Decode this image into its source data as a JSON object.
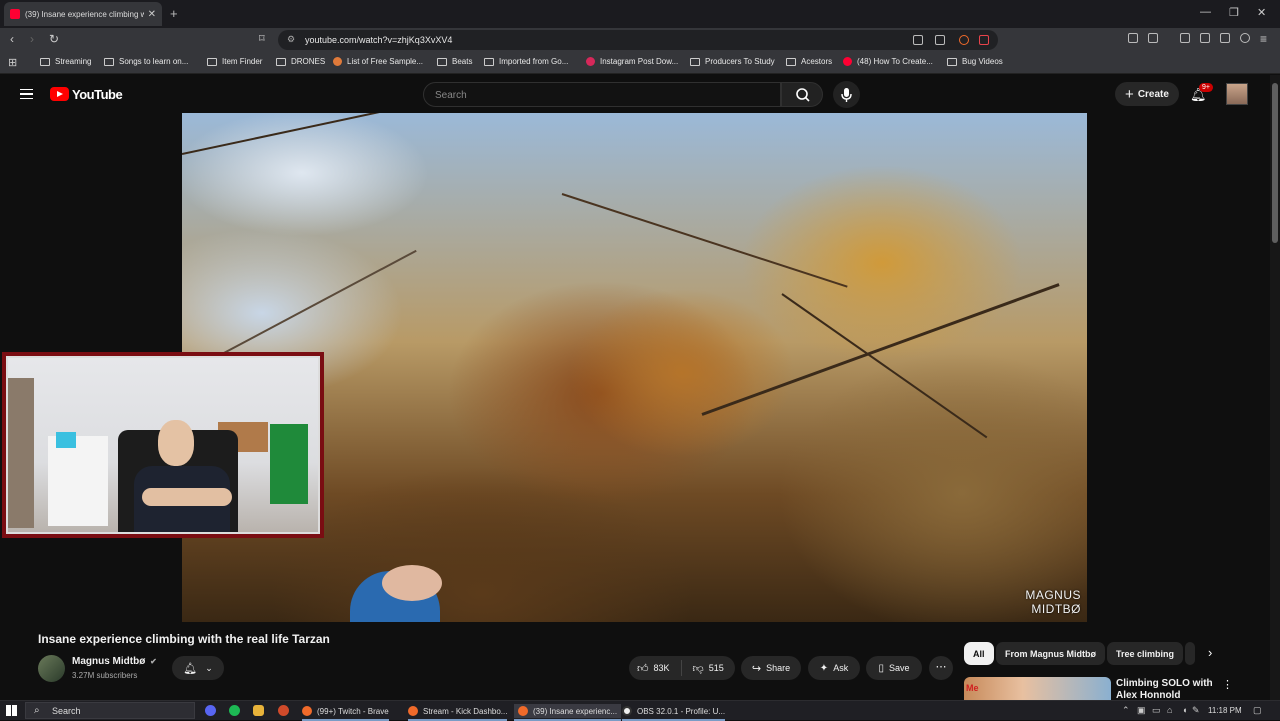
{
  "browser": {
    "active_tab_title": "(39) Insane experience climbing with the real life Tarzan",
    "url": "youtube.com/watch?v=zhjKq3XvXV4",
    "bookmarks": [
      {
        "label": "Streaming",
        "icon": "folder-icon"
      },
      {
        "label": "Songs to learn on...",
        "icon": "folder-icon"
      },
      {
        "label": "Item Finder",
        "icon": "folder-icon"
      },
      {
        "label": "DRONES",
        "icon": "folder-icon"
      },
      {
        "label": "List of Free Sample...",
        "icon": "site-icon"
      },
      {
        "label": "Beats",
        "icon": "folder-icon"
      },
      {
        "label": "Imported from Go...",
        "icon": "folder-icon"
      },
      {
        "label": "Instagram Post Dow...",
        "icon": "site-icon"
      },
      {
        "label": "Producers To Study",
        "icon": "folder-icon"
      },
      {
        "label": "Acestors",
        "icon": "folder-icon"
      },
      {
        "label": "(48) How To Create...",
        "icon": "youtube-icon"
      },
      {
        "label": "Bug Videos",
        "icon": "folder-icon"
      }
    ]
  },
  "youtube": {
    "logo_text": "YouTube",
    "search_placeholder": "Search",
    "create_label": "Create",
    "notification_count": "9+",
    "accent_color": "#ff0000"
  },
  "video": {
    "title": "Insane experience climbing with the real life Tarzan",
    "watermark_line1": "MAGNUS",
    "watermark_line2": "MIDTBØ",
    "channel_name": "Magnus Midtbø",
    "verified_glyph": "✔",
    "subscribers": "3.27M subscribers",
    "likes": "83K",
    "dislikes": "515",
    "share_label": "Share",
    "ask_label": "Ask",
    "save_label": "Save"
  },
  "chips": [
    {
      "label": "All",
      "active": true
    },
    {
      "label": "From Magnus Midtbø",
      "active": false
    },
    {
      "label": "Tree climbing",
      "active": false
    }
  ],
  "recommendation": {
    "title": "Climbing SOLO with Alex Honnold"
  },
  "taskbar": {
    "search_label": "Search",
    "apps": [
      {
        "label": "(99+) Twitch - Brave"
      },
      {
        "label": "Stream - Kick Dashbo..."
      },
      {
        "label": "(39) Insane experienc..."
      },
      {
        "label": "OBS 32.0.1 - Profile: U..."
      }
    ],
    "time": "11:18 PM"
  }
}
